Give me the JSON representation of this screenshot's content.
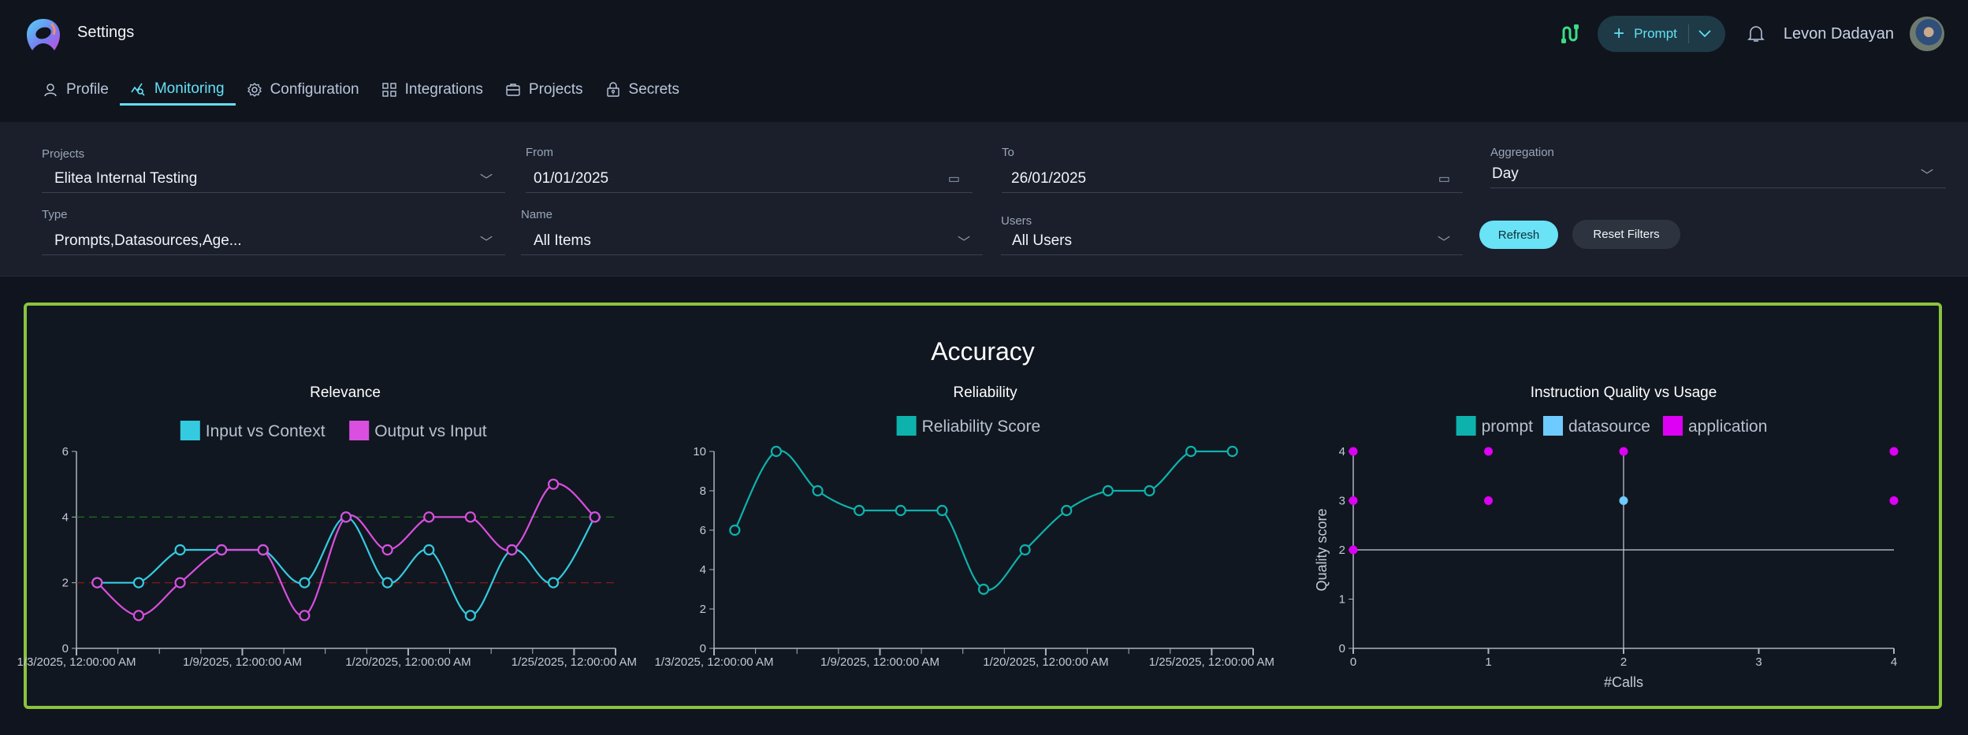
{
  "app": {
    "title": "Settings"
  },
  "tabs": [
    {
      "label": "Profile",
      "icon": "user-icon",
      "active": false
    },
    {
      "label": "Monitoring",
      "icon": "monitoring-icon",
      "active": true
    },
    {
      "label": "Configuration",
      "icon": "gear-icon",
      "active": false
    },
    {
      "label": "Integrations",
      "icon": "grid-icon",
      "active": false
    },
    {
      "label": "Projects",
      "icon": "briefcase-icon",
      "active": false
    },
    {
      "label": "Secrets",
      "icon": "lock-icon",
      "active": false
    }
  ],
  "header": {
    "prompt_button": "Prompt",
    "user_name": "Levon Dadayan"
  },
  "filters": {
    "projects": {
      "label": "Projects",
      "value": "Elitea Internal Testing"
    },
    "from": {
      "label": "From",
      "value": "01/01/2025"
    },
    "to": {
      "label": "To",
      "value": "26/01/2025"
    },
    "aggregation": {
      "label": "Aggregation",
      "value": "Day"
    },
    "type": {
      "label": "Type",
      "value": "Prompts,Datasources,Age..."
    },
    "name": {
      "label": "Name",
      "value": "All Items"
    },
    "users": {
      "label": "Users",
      "value": "All Users"
    },
    "refresh_label": "Refresh",
    "reset_label": "Reset Filters"
  },
  "panel": {
    "title": "Accuracy"
  },
  "colors": {
    "accent": "#62e0f4",
    "panel_border": "#8ac33d",
    "input_vs_context": "#34cbe0",
    "output_vs_input": "#d94fe0",
    "reliability": "#0db2ad",
    "prompt": "#0db2ad",
    "datasource": "#6ecbff",
    "application": "#dd00f5",
    "threshold_high": "#1f7a1f",
    "threshold_low": "#8f1a1a"
  },
  "chart_data": [
    {
      "type": "line",
      "title": "Relevance",
      "xlabel": "",
      "ylabel": "",
      "ylim": [
        0,
        6
      ],
      "yticks": [
        0,
        2,
        4,
        6
      ],
      "x_count": 13,
      "x_tick_labels": [
        {
          "index": 0,
          "label": "1/3/2025, 12:00:00 AM"
        },
        {
          "index": 4,
          "label": "1/9/2025, 12:00:00 AM"
        },
        {
          "index": 8,
          "label": "1/20/2025, 12:00:00 AM"
        },
        {
          "index": 12,
          "label": "1/25/2025, 12:00:00 AM"
        }
      ],
      "legend": "top-center",
      "reference_lines": [
        {
          "value": 4,
          "color": "green",
          "style": "dashed"
        },
        {
          "value": 2,
          "color": "red",
          "style": "dashed"
        }
      ],
      "series": [
        {
          "name": "Input vs Context",
          "values": [
            2,
            2,
            3,
            3,
            3,
            2,
            4,
            2,
            3,
            1,
            3,
            2,
            4
          ]
        },
        {
          "name": "Output vs Input",
          "values": [
            2,
            1,
            2,
            3,
            3,
            1,
            4,
            3,
            4,
            4,
            3,
            5,
            4
          ]
        }
      ]
    },
    {
      "type": "line",
      "title": "Reliability",
      "xlabel": "",
      "ylabel": "",
      "ylim": [
        0,
        10
      ],
      "yticks": [
        0,
        2,
        4,
        6,
        8,
        10
      ],
      "x_count": 13,
      "x_tick_labels": [
        {
          "index": 0,
          "label": "1/3/2025, 12:00:00 AM"
        },
        {
          "index": 4,
          "label": "1/9/2025, 12:00:00 AM"
        },
        {
          "index": 8,
          "label": "1/20/2025, 12:00:00 AM"
        },
        {
          "index": 12,
          "label": "1/25/2025, 12:00:00 AM"
        }
      ],
      "legend": "top-center",
      "series": [
        {
          "name": "Reliability Score",
          "values": [
            6,
            10,
            8,
            7,
            7,
            7,
            3,
            5,
            7,
            8,
            8,
            10,
            10
          ]
        }
      ]
    },
    {
      "type": "scatter",
      "title": "Instruction Quality vs Usage",
      "xlabel": "#Calls",
      "ylabel": "Quality score",
      "xlim": [
        0,
        4
      ],
      "ylim": [
        0,
        4
      ],
      "xticks": [
        0,
        1,
        2,
        3,
        4
      ],
      "yticks": [
        0,
        1,
        2,
        3,
        4
      ],
      "legend": "top-center",
      "reference_lines": [
        {
          "axis": "y",
          "value": 2
        },
        {
          "axis": "x",
          "value": 2
        }
      ],
      "series": [
        {
          "name": "prompt",
          "points": []
        },
        {
          "name": "datasource",
          "points": [
            [
              2,
              3
            ]
          ]
        },
        {
          "name": "application",
          "points": [
            [
              0,
              4
            ],
            [
              0,
              3
            ],
            [
              0,
              2
            ],
            [
              1,
              4
            ],
            [
              1,
              3
            ],
            [
              2,
              4
            ],
            [
              4,
              4
            ],
            [
              4,
              3
            ]
          ]
        }
      ]
    }
  ]
}
